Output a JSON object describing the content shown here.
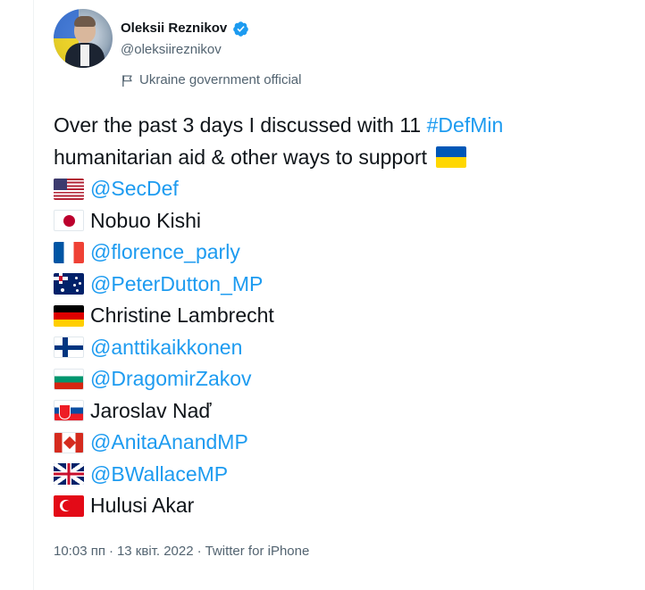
{
  "author": {
    "name": "Oleksii Reznikov",
    "handle": "@oleksiireznikov",
    "label": "Ukraine government official",
    "verified": true
  },
  "tweet": {
    "intro_line1_prefix": "Over the past 3 days I discussed with 11 ",
    "intro_hashtag": "#DefMin",
    "intro_line2": "humanitarian aid & other ways to support",
    "intro_flag": "flag-ukraine",
    "entries": [
      {
        "flag": "flag-usa",
        "text": "@SecDef",
        "is_mention": true
      },
      {
        "flag": "flag-japan",
        "text": "Nobuo Kishi",
        "is_mention": false
      },
      {
        "flag": "flag-france",
        "text": "@florence_parly",
        "is_mention": true
      },
      {
        "flag": "flag-australia",
        "text": "@PeterDutton_MP",
        "is_mention": true
      },
      {
        "flag": "flag-germany",
        "text": "Christine Lambrecht",
        "is_mention": false
      },
      {
        "flag": "flag-finland",
        "text": "@anttikaikkonen",
        "is_mention": true
      },
      {
        "flag": "flag-bulgaria",
        "text": "@DragomirZakov",
        "is_mention": true
      },
      {
        "flag": "flag-slovakia",
        "text": "Jaroslav Naď",
        "is_mention": false
      },
      {
        "flag": "flag-canada",
        "text": "@AnitaAnandMP",
        "is_mention": true
      },
      {
        "flag": "flag-uk",
        "text": "@BWallaceMP",
        "is_mention": true
      },
      {
        "flag": "flag-turkey",
        "text": "Hulusi Akar",
        "is_mention": false
      }
    ]
  },
  "meta": {
    "time": "10:03 пп",
    "separator": "·",
    "date": "13 квіт. 2022",
    "separator2": "·",
    "source": "Twitter for iPhone"
  },
  "colors": {
    "link": "#1d9bf0",
    "text": "#0f1419",
    "secondary": "#536471",
    "verified": "#1d9bf0"
  },
  "icons": {
    "verified": "verified-badge-icon",
    "label": "government-flag-icon"
  }
}
